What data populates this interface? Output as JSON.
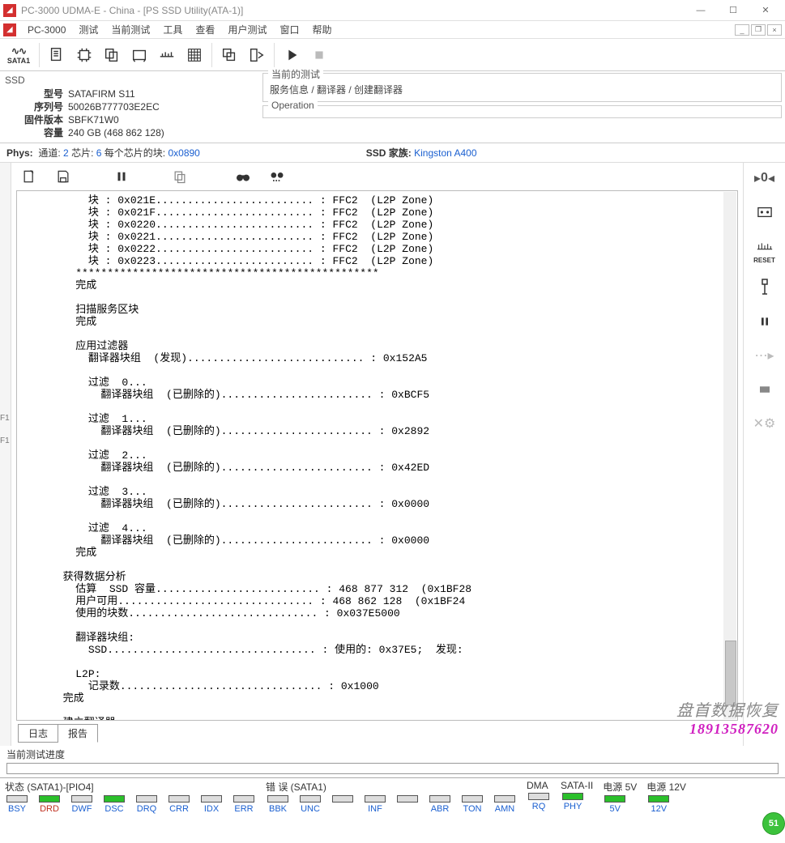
{
  "titlebar": {
    "title": "PC-3000 UDMA-E - China - [PS SSD Utility(ATA-1)]"
  },
  "menubar": {
    "app": "PC-3000",
    "items": [
      "测试",
      "当前测试",
      "工具",
      "查看",
      "用户测试",
      "窗口",
      "帮助"
    ]
  },
  "toolbar": {
    "sata_label": "SATA1"
  },
  "device": {
    "group": "SSD",
    "model_label": "型号",
    "model": "SATAFIRM   S11",
    "serial_label": "序列号",
    "serial": "50026B777703E2EC",
    "fw_label": "固件版本",
    "fw": "SBFK71W0",
    "cap_label": "容量",
    "cap": "240 GB (468 862 128)"
  },
  "current_test": {
    "box_title": "当前的测试",
    "breadcrumb": "服务信息 / 翻译器 / 创建翻译器",
    "op_title": "Operation",
    "op_value": ""
  },
  "phys": {
    "label": "Phys:",
    "channels_label": "通道:",
    "channels": "2",
    "chips_label": "芯片:",
    "chips": "6",
    "blocks_label": "每个芯片的块:",
    "blocks": "0x0890",
    "family_label": "SSD 家族:",
    "family": "Kingston A400"
  },
  "log_tabs": {
    "log": "日志",
    "report": "报告"
  },
  "progress": {
    "label": "当前测试进度"
  },
  "watermark": {
    "line1": "盘首数据恢复",
    "line2": "18913587620"
  },
  "status": {
    "grp1_title": "状态 (SATA1)-[PIO4]",
    "grp1": [
      "BSY",
      "DRD",
      "DWF",
      "DSC",
      "DRQ",
      "CRR",
      "IDX",
      "ERR"
    ],
    "grp1_on": [
      false,
      true,
      false,
      true,
      false,
      false,
      false,
      false
    ],
    "grp2_title": "错 误 (SATA1)",
    "grp2": [
      "BBK",
      "UNC",
      "",
      "INF",
      "",
      "ABR",
      "TON",
      "AMN"
    ],
    "grp3_title": "DMA",
    "grp3": [
      "RQ"
    ],
    "grp4_title": "SATA-II",
    "grp4": [
      "PHY"
    ],
    "grp4_on": [
      true
    ],
    "grp5_title": "电源 5V",
    "grp5": [
      "5V"
    ],
    "grp5_on": [
      true
    ],
    "grp6_title": "电源 12V",
    "grp6": [
      "12V"
    ],
    "grp6_on": [
      true
    ]
  },
  "badge": "51",
  "right_tools": {
    "reset": "RESET"
  },
  "log_text": "           块 : 0x021E......................... : FFC2  (L2P Zone)\n           块 : 0x021F......................... : FFC2  (L2P Zone)\n           块 : 0x0220......................... : FFC2  (L2P Zone)\n           块 : 0x0221......................... : FFC2  (L2P Zone)\n           块 : 0x0222......................... : FFC2  (L2P Zone)\n           块 : 0x0223......................... : FFC2  (L2P Zone)\n         ************************************************\n         完成\n\n         扫描服务区块\n         完成\n\n         应用过滤器\n           翻译器块组  (发现)............................ : 0x152A5\n\n           过滤  0...\n             翻译器块组  (已删除的)........................ : 0xBCF5\n\n           过滤  1...\n             翻译器块组  (已删除的)........................ : 0x2892\n\n           过滤  2...\n             翻译器块组  (已删除的)........................ : 0x42ED\n\n           过滤  3...\n             翻译器块组  (已删除的)........................ : 0x0000\n\n           过滤  4...\n             翻译器块组  (已删除的)........................ : 0x0000\n         完成\n\n       获得数据分析\n         估算  SSD 容量.......................... : 468 877 312  (0x1BF28\n         用户可用............................... : 468 862 128  (0x1BF24\n         使用的块数.............................. : 0x037E5000\n\n         翻译器块组:\n           SSD................................. : 使用的: 0x37E5;  发现:\n\n         L2P:\n           记录数................................ : 0x1000\n       完成\n\n       建立翻译器\n       完成\n     **********************************************************\n     完成\n   ************************************************************\n 测试完成"
}
